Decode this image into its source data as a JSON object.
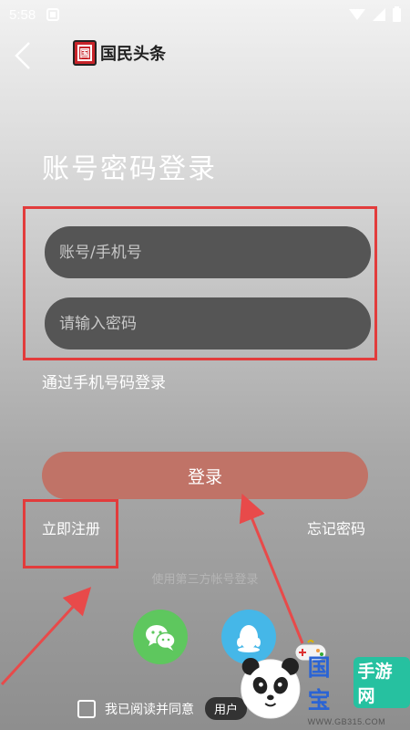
{
  "status_bar": {
    "time": "5:58"
  },
  "header": {
    "logo_glyph": "国",
    "logo_text": "国民头条"
  },
  "page": {
    "title": "账号密码登录"
  },
  "form": {
    "account_placeholder": "账号/手机号",
    "password_placeholder": "请输入密码",
    "phone_login_link": "通过手机号码登录",
    "login_button": "登录",
    "register_link": "立即注册",
    "forgot_link": "忘记密码"
  },
  "third_party": {
    "label": "使用第三方帐号登录",
    "providers": [
      "wechat-icon",
      "qq-icon"
    ]
  },
  "agreement": {
    "text": "我已阅读并同意",
    "pill": "用户"
  },
  "watermark": {
    "title_left": "国宝",
    "title_right": "手游网",
    "url": "WWW.GB315.COM"
  },
  "colors": {
    "login_button": "#c07367",
    "input_bg": "#555555",
    "highlight_box": "#e23c3c",
    "wechat": "#5ec75e",
    "qq": "#45b7e8",
    "logo_red": "#c8242a"
  }
}
